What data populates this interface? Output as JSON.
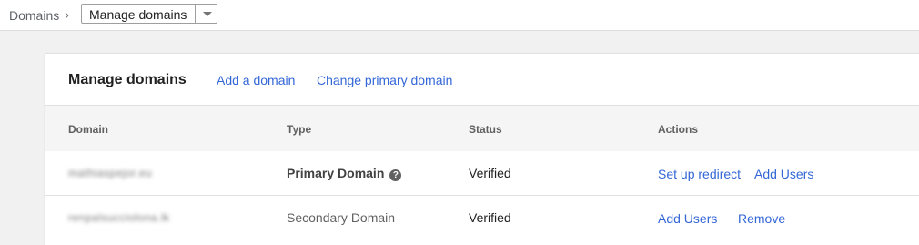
{
  "breadcrumb": {
    "root": "Domains",
    "separator": "›",
    "current": "Manage domains"
  },
  "card": {
    "title": "Manage domains",
    "links": {
      "add_domain": "Add a domain",
      "change_primary": "Change primary domain"
    }
  },
  "table": {
    "headers": {
      "domain": "Domain",
      "type": "Type",
      "status": "Status",
      "actions": "Actions"
    },
    "rows": [
      {
        "domain": "mathiaspejor.eu",
        "type": "Primary Domain",
        "status": "Verified",
        "actions": [
          "Set up redirect",
          "Add Users"
        ]
      },
      {
        "domain": "renpalsucciolona.lk",
        "type": "Secondary Domain",
        "status": "Verified",
        "actions": [
          "Add Users",
          "Remove"
        ]
      }
    ]
  },
  "icons": {
    "help": "help-circle-icon",
    "dropdown": "chevron-down-icon"
  },
  "colors": {
    "link": "#3367d6",
    "page_bg": "#f1f1f1",
    "header_bg": "#f5f5f5"
  }
}
